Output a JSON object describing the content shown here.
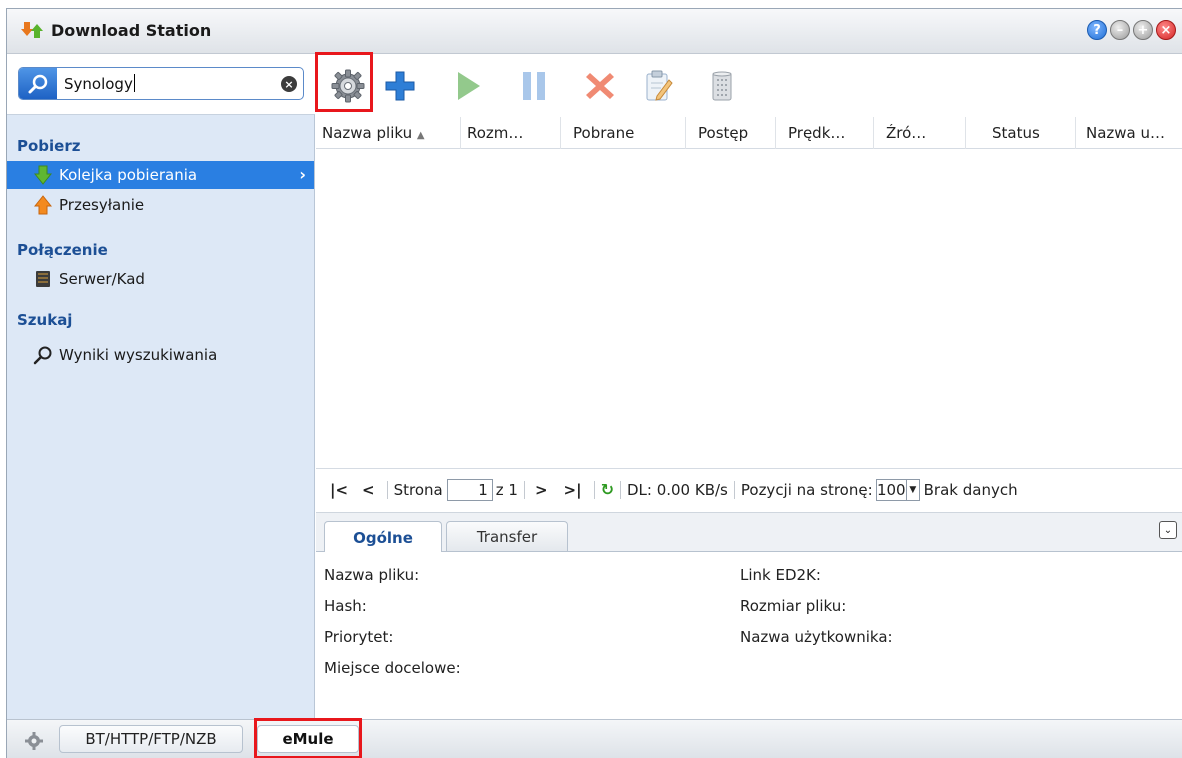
{
  "window": {
    "title": "Download Station",
    "buttons": [
      "help",
      "minimize",
      "maximize",
      "close"
    ]
  },
  "search": {
    "value": "Synology"
  },
  "toolbar": {
    "buttons": [
      "settings-gear-icon",
      "add-plus-icon",
      "resume-play-icon",
      "pause-icon",
      "delete-x-icon",
      "edit-icon",
      "clear-trash-icon"
    ]
  },
  "sidebar": {
    "sections": [
      {
        "heading": "Pobierz",
        "items": [
          {
            "label": "Kolejka pobierania",
            "icon": "download-arrow-icon",
            "active": true
          },
          {
            "label": "Przesyłanie",
            "icon": "upload-arrow-icon"
          }
        ]
      },
      {
        "heading": "Połączenie",
        "items": [
          {
            "label": "Serwer/Kad",
            "icon": "server-icon"
          }
        ]
      },
      {
        "heading": "Szukaj",
        "items": [
          {
            "label": "Wyniki wyszukiwania",
            "icon": "search-icon"
          }
        ]
      }
    ]
  },
  "grid": {
    "columns": [
      "Nazwa pliku",
      "Rozm…",
      "Pobrane",
      "Postęp",
      "Prędk…",
      "Źró…",
      "Status",
      "Nazwa u…"
    ],
    "sort_indicator": "▲"
  },
  "pager": {
    "page_label": "Strona",
    "page_value": "1",
    "of_label": "z 1",
    "dl_speed": "DL: 0.00 KB/s",
    "per_page_label": "Pozycji na stronę:",
    "per_page_value": "100",
    "no_data": "Brak danych"
  },
  "details": {
    "tabs": [
      "Ogólne",
      "Transfer"
    ],
    "left_labels": [
      "Nazwa pliku:",
      "Hash:",
      "Priorytet:",
      "Miejsce docelowe:"
    ],
    "right_labels": [
      "Link ED2K:",
      "Rozmiar pliku:",
      "Nazwa użytkownika:"
    ]
  },
  "bottom_tabs": [
    "BT/HTTP/FTP/NZB",
    "eMule"
  ],
  "colors": {
    "accent": "#2a7fe2",
    "highlight": "#e8171c",
    "sidebar_bg": "#dde8f6",
    "heading": "#1c4f95"
  }
}
